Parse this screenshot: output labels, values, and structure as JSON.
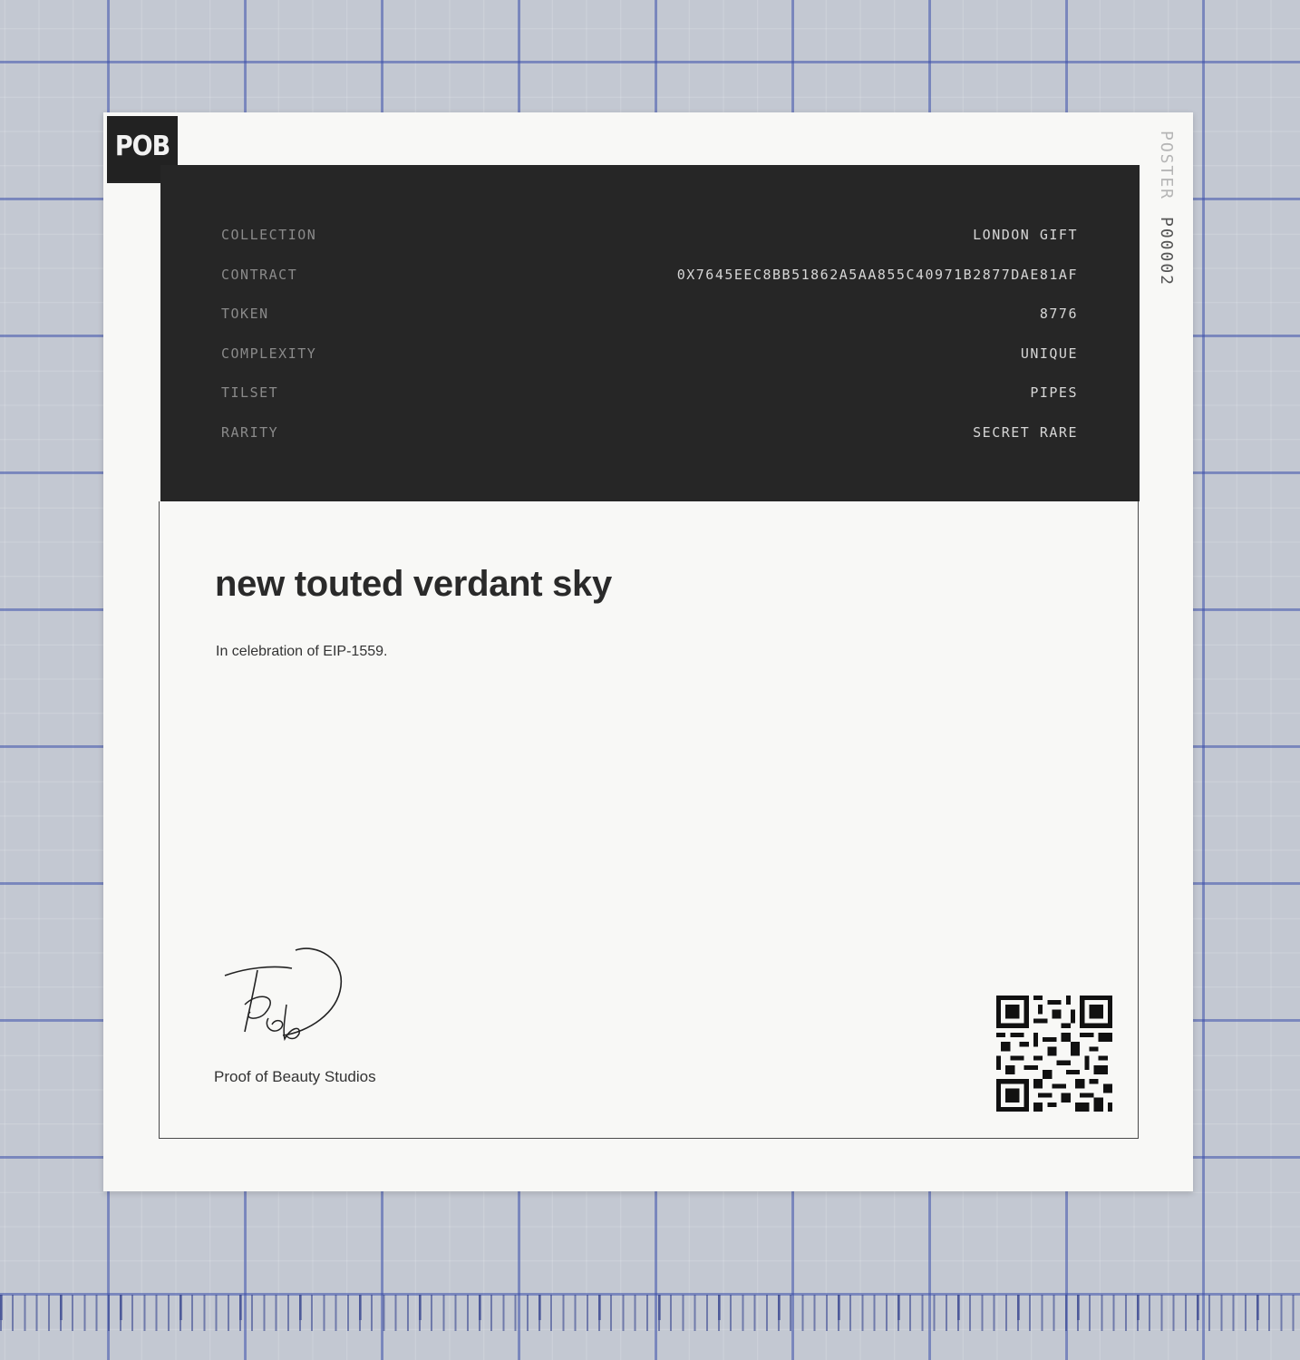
{
  "poster": {
    "logo_text": "POB",
    "side_label_word": "POSTER",
    "side_label_code": "P00002",
    "metadata": [
      {
        "label": "COLLECTION",
        "value": "LONDON GIFT"
      },
      {
        "label": "CONTRACT",
        "value": "0X7645EEC8BB51862A5AA855C40971B2877DAE81AF"
      },
      {
        "label": "TOKEN",
        "value": "8776"
      },
      {
        "label": "COMPLEXITY",
        "value": "UNIQUE"
      },
      {
        "label": "TILSET",
        "value": "PIPES"
      },
      {
        "label": "RARITY",
        "value": "SECRET RARE"
      }
    ],
    "title": "new touted verdant sky",
    "subtitle": "In celebration of EIP-1559.",
    "signature_text": "Pob",
    "studio_name": "Proof of Beauty Studios",
    "qr_icon": "qr-code-icon"
  },
  "colors": {
    "panel": "#262626",
    "paper": "#f8f8f6",
    "grid_line": "#3c50aa",
    "mat": "#c3c8d2"
  }
}
